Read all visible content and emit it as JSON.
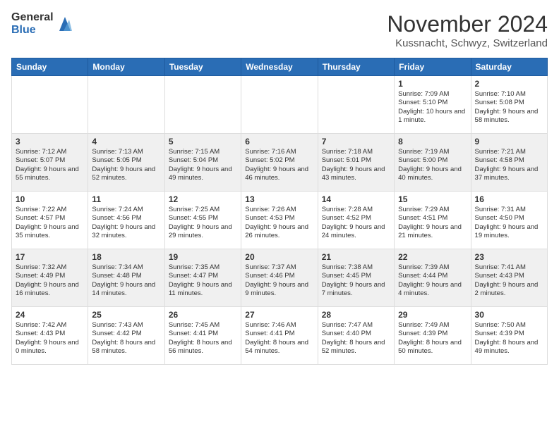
{
  "header": {
    "logo_general": "General",
    "logo_blue": "Blue",
    "month_title": "November 2024",
    "location": "Kussnacht, Schwyz, Switzerland"
  },
  "days_of_week": [
    "Sunday",
    "Monday",
    "Tuesday",
    "Wednesday",
    "Thursday",
    "Friday",
    "Saturday"
  ],
  "weeks": [
    [
      {
        "day": "",
        "info": ""
      },
      {
        "day": "",
        "info": ""
      },
      {
        "day": "",
        "info": ""
      },
      {
        "day": "",
        "info": ""
      },
      {
        "day": "",
        "info": ""
      },
      {
        "day": "1",
        "info": "Sunrise: 7:09 AM\nSunset: 5:10 PM\nDaylight: 10 hours and 1 minute."
      },
      {
        "day": "2",
        "info": "Sunrise: 7:10 AM\nSunset: 5:08 PM\nDaylight: 9 hours and 58 minutes."
      }
    ],
    [
      {
        "day": "3",
        "info": "Sunrise: 7:12 AM\nSunset: 5:07 PM\nDaylight: 9 hours and 55 minutes."
      },
      {
        "day": "4",
        "info": "Sunrise: 7:13 AM\nSunset: 5:05 PM\nDaylight: 9 hours and 52 minutes."
      },
      {
        "day": "5",
        "info": "Sunrise: 7:15 AM\nSunset: 5:04 PM\nDaylight: 9 hours and 49 minutes."
      },
      {
        "day": "6",
        "info": "Sunrise: 7:16 AM\nSunset: 5:02 PM\nDaylight: 9 hours and 46 minutes."
      },
      {
        "day": "7",
        "info": "Sunrise: 7:18 AM\nSunset: 5:01 PM\nDaylight: 9 hours and 43 minutes."
      },
      {
        "day": "8",
        "info": "Sunrise: 7:19 AM\nSunset: 5:00 PM\nDaylight: 9 hours and 40 minutes."
      },
      {
        "day": "9",
        "info": "Sunrise: 7:21 AM\nSunset: 4:58 PM\nDaylight: 9 hours and 37 minutes."
      }
    ],
    [
      {
        "day": "10",
        "info": "Sunrise: 7:22 AM\nSunset: 4:57 PM\nDaylight: 9 hours and 35 minutes."
      },
      {
        "day": "11",
        "info": "Sunrise: 7:24 AM\nSunset: 4:56 PM\nDaylight: 9 hours and 32 minutes."
      },
      {
        "day": "12",
        "info": "Sunrise: 7:25 AM\nSunset: 4:55 PM\nDaylight: 9 hours and 29 minutes."
      },
      {
        "day": "13",
        "info": "Sunrise: 7:26 AM\nSunset: 4:53 PM\nDaylight: 9 hours and 26 minutes."
      },
      {
        "day": "14",
        "info": "Sunrise: 7:28 AM\nSunset: 4:52 PM\nDaylight: 9 hours and 24 minutes."
      },
      {
        "day": "15",
        "info": "Sunrise: 7:29 AM\nSunset: 4:51 PM\nDaylight: 9 hours and 21 minutes."
      },
      {
        "day": "16",
        "info": "Sunrise: 7:31 AM\nSunset: 4:50 PM\nDaylight: 9 hours and 19 minutes."
      }
    ],
    [
      {
        "day": "17",
        "info": "Sunrise: 7:32 AM\nSunset: 4:49 PM\nDaylight: 9 hours and 16 minutes."
      },
      {
        "day": "18",
        "info": "Sunrise: 7:34 AM\nSunset: 4:48 PM\nDaylight: 9 hours and 14 minutes."
      },
      {
        "day": "19",
        "info": "Sunrise: 7:35 AM\nSunset: 4:47 PM\nDaylight: 9 hours and 11 minutes."
      },
      {
        "day": "20",
        "info": "Sunrise: 7:37 AM\nSunset: 4:46 PM\nDaylight: 9 hours and 9 minutes."
      },
      {
        "day": "21",
        "info": "Sunrise: 7:38 AM\nSunset: 4:45 PM\nDaylight: 9 hours and 7 minutes."
      },
      {
        "day": "22",
        "info": "Sunrise: 7:39 AM\nSunset: 4:44 PM\nDaylight: 9 hours and 4 minutes."
      },
      {
        "day": "23",
        "info": "Sunrise: 7:41 AM\nSunset: 4:43 PM\nDaylight: 9 hours and 2 minutes."
      }
    ],
    [
      {
        "day": "24",
        "info": "Sunrise: 7:42 AM\nSunset: 4:43 PM\nDaylight: 9 hours and 0 minutes."
      },
      {
        "day": "25",
        "info": "Sunrise: 7:43 AM\nSunset: 4:42 PM\nDaylight: 8 hours and 58 minutes."
      },
      {
        "day": "26",
        "info": "Sunrise: 7:45 AM\nSunset: 4:41 PM\nDaylight: 8 hours and 56 minutes."
      },
      {
        "day": "27",
        "info": "Sunrise: 7:46 AM\nSunset: 4:41 PM\nDaylight: 8 hours and 54 minutes."
      },
      {
        "day": "28",
        "info": "Sunrise: 7:47 AM\nSunset: 4:40 PM\nDaylight: 8 hours and 52 minutes."
      },
      {
        "day": "29",
        "info": "Sunrise: 7:49 AM\nSunset: 4:39 PM\nDaylight: 8 hours and 50 minutes."
      },
      {
        "day": "30",
        "info": "Sunrise: 7:50 AM\nSunset: 4:39 PM\nDaylight: 8 hours and 49 minutes."
      }
    ]
  ]
}
